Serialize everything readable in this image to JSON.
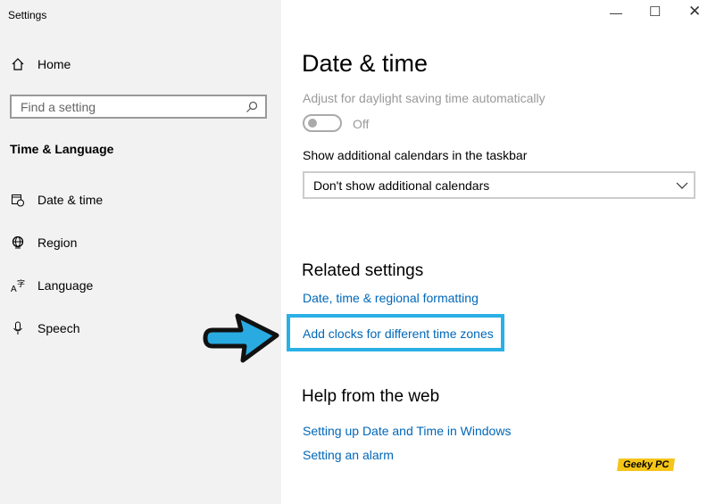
{
  "app_title": "Settings",
  "sidebar": {
    "home": "Home",
    "search_placeholder": "Find a setting",
    "section": "Time & Language",
    "items": [
      {
        "label": "Date & time",
        "icon": "calendar-clock-icon"
      },
      {
        "label": "Region",
        "icon": "globe-icon"
      },
      {
        "label": "Language",
        "icon": "language-icon"
      },
      {
        "label": "Speech",
        "icon": "microphone-icon"
      }
    ]
  },
  "main": {
    "title": "Date & time",
    "daylight_label": "Adjust for daylight saving time automatically",
    "daylight_toggle": "Off",
    "calendars_label": "Show additional calendars in the taskbar",
    "calendars_value": "Don't show additional calendars",
    "related_heading": "Related settings",
    "related_links": [
      "Date, time & regional formatting",
      "Add clocks for different time zones"
    ],
    "help_heading": "Help from the web",
    "help_links": [
      "Setting up Date and Time in Windows",
      "Setting an alarm"
    ]
  },
  "watermark": "Geeky PC",
  "colors": {
    "link": "#0067b8",
    "highlight": "#2ab0e6",
    "arrow": "#29abe2"
  }
}
